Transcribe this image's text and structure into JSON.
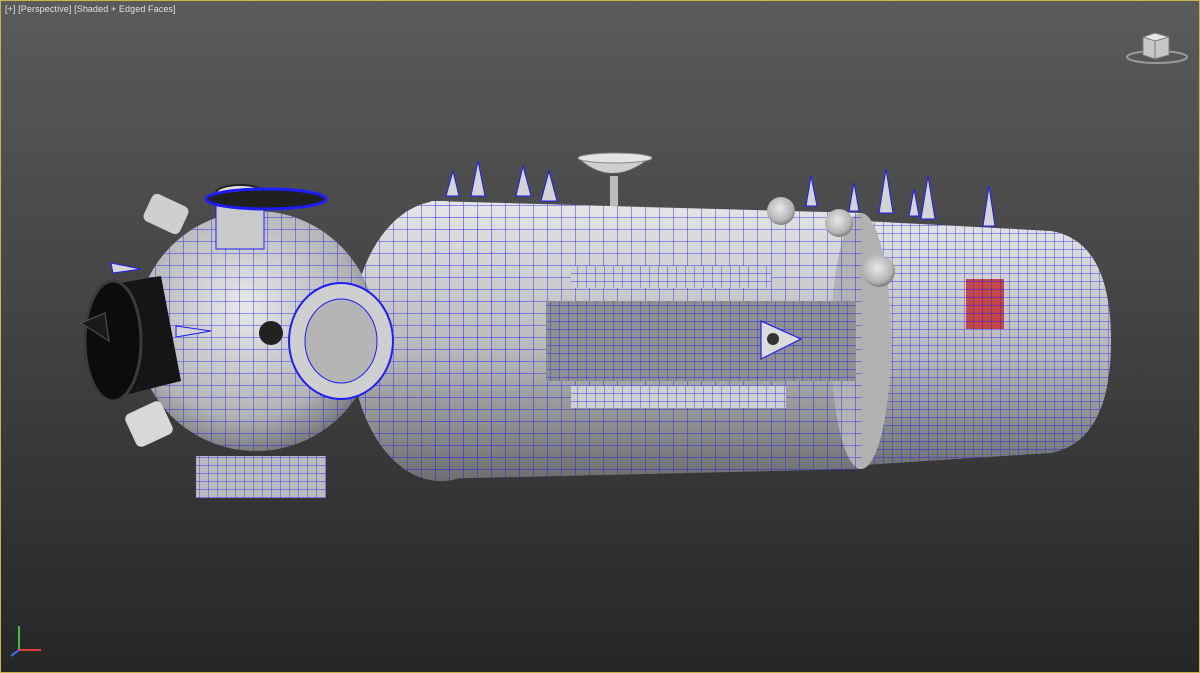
{
  "viewport": {
    "label_parts": [
      "[+]",
      "[Perspective]",
      "[Shaded + Edged Faces]"
    ],
    "accent_border": "#c8b44a",
    "wire_color": "#1a1aff",
    "mesh_color": "#bdbdbd"
  },
  "icons": {
    "viewcube": "viewcube-icon",
    "axis": "axis-tripod-icon"
  }
}
